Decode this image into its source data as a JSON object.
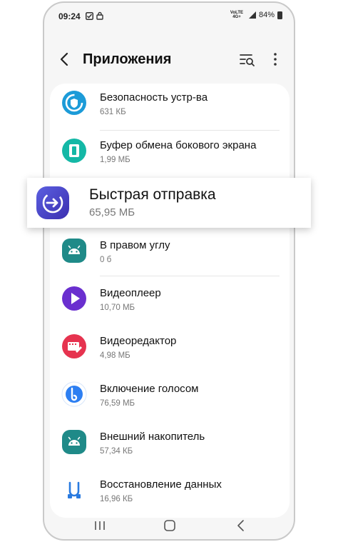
{
  "status": {
    "time": "09:24",
    "network": "VoLTE 4G+",
    "battery": "84%"
  },
  "header": {
    "title": "Приложения"
  },
  "apps": [
    {
      "name": "Безопасность устр-ва",
      "size": "631 КБ",
      "icon": "device-security-icon",
      "color": "#1c9bd8"
    },
    {
      "name": "Буфер обмена бокового экрана",
      "size": "1,99 МБ",
      "icon": "clipboard-edge-icon",
      "color": "#14b8a6"
    },
    {
      "name": "В правом углу",
      "size": "0 б",
      "icon": "android-icon",
      "color": "#1f8a88"
    },
    {
      "name": "Видеоплеер",
      "size": "10,70 МБ",
      "icon": "video-player-icon",
      "color": "#6a2fcf"
    },
    {
      "name": "Видеоредактор",
      "size": "4,98 МБ",
      "icon": "video-editor-icon",
      "color": "#e6334f"
    },
    {
      "name": "Включение голосом",
      "size": "76,59 МБ",
      "icon": "bixby-voice-icon",
      "color": "#2d7ff2"
    },
    {
      "name": "Внешний накопитель",
      "size": "57,34 КБ",
      "icon": "android-icon",
      "color": "#1f8a88"
    },
    {
      "name": "Восстановление данных",
      "size": "16,96 КБ",
      "icon": "data-restore-icon",
      "color": "#2a7be0"
    }
  ],
  "highlight": {
    "name": "Быстрая отправка",
    "size": "65,95 МБ",
    "icon": "quick-share-icon",
    "color": "#4f46c8"
  }
}
